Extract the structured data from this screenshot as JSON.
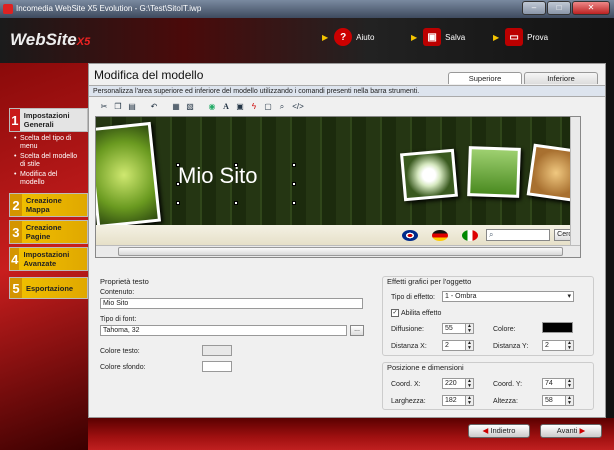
{
  "window": {
    "title": "Incomedia WebSite X5 Evolution - G:\\Test\\SitoIT.iwp",
    "minimize": "–",
    "maximize": "□",
    "close": "✕"
  },
  "logo": {
    "text": "WebSite",
    "suffix": "X5"
  },
  "header_buttons": {
    "help": "Aiuto",
    "save": "Salva",
    "test": "Prova"
  },
  "steps": [
    {
      "num": "1",
      "label": "Impostazioni Generali"
    },
    {
      "num": "2",
      "label": "Creazione Mappa"
    },
    {
      "num": "3",
      "label": "Creazione Pagine"
    },
    {
      "num": "4",
      "label": "Impostazioni Avanzate"
    },
    {
      "num": "5",
      "label": "Esportazione"
    }
  ],
  "substeps": [
    "Scelta del tipo di menu",
    "Scelta del modello di stile",
    "Modifica del modello"
  ],
  "page": {
    "title": "Modifica del modello",
    "description": "Personalizza l'area superiore ed inferiore del modello utilizzando i comandi presenti nella barra strumenti.",
    "tabs": [
      "Superiore",
      "Inferiore"
    ]
  },
  "toolbar_icons": [
    "cut-icon",
    "copy-icon",
    "paste-icon",
    "undo-icon",
    "bring-front-icon",
    "send-back-icon",
    "globe-icon",
    "text-icon",
    "image-icon",
    "flash-icon",
    "html-icon",
    "search-icon",
    "code-icon"
  ],
  "preview": {
    "site_name": "Mio Sito",
    "search_placeholder": "",
    "search_button": "Cerca"
  },
  "text_props": {
    "group_title": "Proprietà testo",
    "content_label": "Contenuto:",
    "content_value": "Mio Sito",
    "font_label": "Tipo di font:",
    "font_value": "Tahoma, 32",
    "font_button": "...",
    "text_color_label": "Colore testo:",
    "bg_color_label": "Colore sfondo:"
  },
  "effects": {
    "group_title": "Effetti grafici per l'oggetto",
    "type_label": "Tipo di effetto:",
    "type_value": "1 - Ombra",
    "enable_label": "Abilita effetto",
    "diffusion_label": "Diffusione:",
    "diffusion_value": "55",
    "color_label": "Colore:",
    "dist_x_label": "Distanza X:",
    "dist_x_value": "2",
    "dist_y_label": "Distanza Y:",
    "dist_y_value": "2"
  },
  "position": {
    "group_title": "Posizione e dimensioni",
    "coord_x_label": "Coord. X:",
    "coord_x_value": "220",
    "coord_y_label": "Coord. Y:",
    "coord_y_value": "74",
    "width_label": "Larghezza:",
    "width_value": "182",
    "height_label": "Altezza:",
    "height_value": "58"
  },
  "nav": {
    "back": "Indietro",
    "next": "Avanti"
  },
  "colors": {
    "accent": "#c91a1a",
    "highlight": "#f2c200",
    "shadow_color": "#000000"
  }
}
